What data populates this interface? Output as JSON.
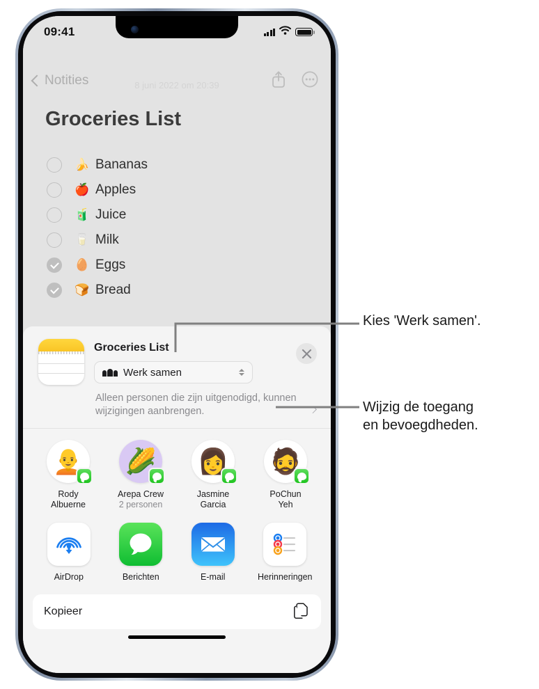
{
  "status_bar": {
    "time": "09:41",
    "cellular_icon": "signal-bars-icon",
    "wifi_icon": "wifi-icon",
    "battery_icon": "battery-full-icon"
  },
  "note_screen": {
    "back_label": "Notities",
    "date_label": "8 juni 2022 om 20:39",
    "title": "Groceries List",
    "share_icon": "share-icon",
    "more_icon": "ellipsis-circle-icon",
    "checklist": [
      {
        "emoji": "🍌",
        "label": "Bananas",
        "checked": false
      },
      {
        "emoji": "🍎",
        "label": "Apples",
        "checked": false
      },
      {
        "emoji": "🧃",
        "label": "Juice",
        "checked": false
      },
      {
        "emoji": "🥛",
        "label": "Milk",
        "checked": false
      },
      {
        "emoji": "🥚",
        "label": "Eggs",
        "checked": true
      },
      {
        "emoji": "🍞",
        "label": "Bread",
        "checked": true
      }
    ]
  },
  "share_sheet": {
    "app_icon": "notes-app-icon",
    "title": "Groceries List",
    "dropdown": {
      "icon": "people-icon",
      "value": "Werk samen",
      "chevron_icon": "up-down-chevron-icon"
    },
    "close_icon": "close-icon",
    "permission_text": "Alleen personen die zijn uitgenodigd, kunnen wijzigingen aanbrengen.",
    "permission_chevron_icon": "chevron-right-icon",
    "contacts": [
      {
        "name": "Rody\nAlbuerne",
        "sub": "",
        "emoji": "🧑‍🦲",
        "bg": "#ffffff",
        "badge_icon": "messages-badge-icon"
      },
      {
        "name": "Arepa Crew",
        "sub": "2 personen",
        "emoji": "🌽",
        "bg": "#d9c9f4",
        "badge_icon": "messages-badge-icon"
      },
      {
        "name": "Jasmine\nGarcia",
        "sub": "",
        "emoji": "👩",
        "bg": "#ffffff",
        "badge_icon": "messages-badge-icon"
      },
      {
        "name": "PoChun\nYeh",
        "sub": "",
        "emoji": "🧔",
        "bg": "#ffffff",
        "badge_icon": "messages-badge-icon"
      }
    ],
    "apps": [
      {
        "name": "AirDrop",
        "icon": "airdrop-icon"
      },
      {
        "name": "Berichten",
        "icon": "messages-icon"
      },
      {
        "name": "E-mail",
        "icon": "mail-icon"
      },
      {
        "name": "Herinneringen",
        "icon": "reminders-icon"
      }
    ],
    "actions": [
      {
        "label": "Kopieer",
        "icon": "copy-icon"
      }
    ]
  },
  "callouts": [
    {
      "text": "Kies 'Werk samen'."
    },
    {
      "text": "Wijzig de toegang\nen bevoegdheden."
    }
  ]
}
